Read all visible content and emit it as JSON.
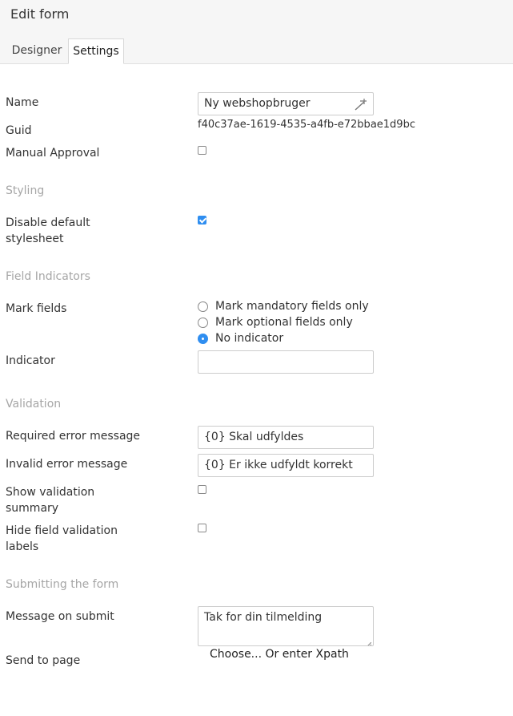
{
  "header": {
    "title": "Edit form",
    "tabs": [
      {
        "label": "Designer",
        "active": false
      },
      {
        "label": "Settings",
        "active": true
      }
    ]
  },
  "fields": {
    "name": {
      "label": "Name",
      "value": "Ny webshopbruger"
    },
    "guid": {
      "label": "Guid",
      "value": "f40c37ae-1619-4535-a4fb-e72bbae1d9bc"
    },
    "manual_approval": {
      "label": "Manual Approval",
      "checked": false
    }
  },
  "styling": {
    "section_title": "Styling",
    "disable_default_stylesheet": {
      "label_line1": "Disable default",
      "label_line2": "stylesheet",
      "checked": true
    }
  },
  "field_indicators": {
    "section_title": "Field Indicators",
    "mark_fields": {
      "label": "Mark fields",
      "options": [
        {
          "label": "Mark mandatory fields only",
          "selected": false
        },
        {
          "label": "Mark optional fields only",
          "selected": false
        },
        {
          "label": "No indicator",
          "selected": true
        }
      ]
    },
    "indicator": {
      "label": "Indicator",
      "value": ""
    }
  },
  "validation": {
    "section_title": "Validation",
    "required_error": {
      "label": "Required error message",
      "value": "{0} Skal udfyldes"
    },
    "invalid_error": {
      "label": "Invalid error message",
      "value": "{0} Er ikke udfyldt korrekt"
    },
    "show_summary": {
      "label_line1": "Show validation",
      "label_line2": "summary",
      "checked": false
    },
    "hide_labels": {
      "label_line1": "Hide field validation",
      "label_line2": "labels",
      "checked": false
    }
  },
  "submitting": {
    "section_title": "Submitting the form",
    "message_on_submit": {
      "label": "Message on submit",
      "value": "Tak for din tilmelding"
    },
    "send_to_page": {
      "label": "Send to page",
      "choose_text": "Choose... Or enter Xpath"
    }
  },
  "colors": {
    "accent": "#2f8ef0",
    "section_title": "#a6a6a6",
    "header_bg": "#f6f6f6"
  },
  "icons": {
    "name_field_icon": "magic-wand-icon"
  }
}
